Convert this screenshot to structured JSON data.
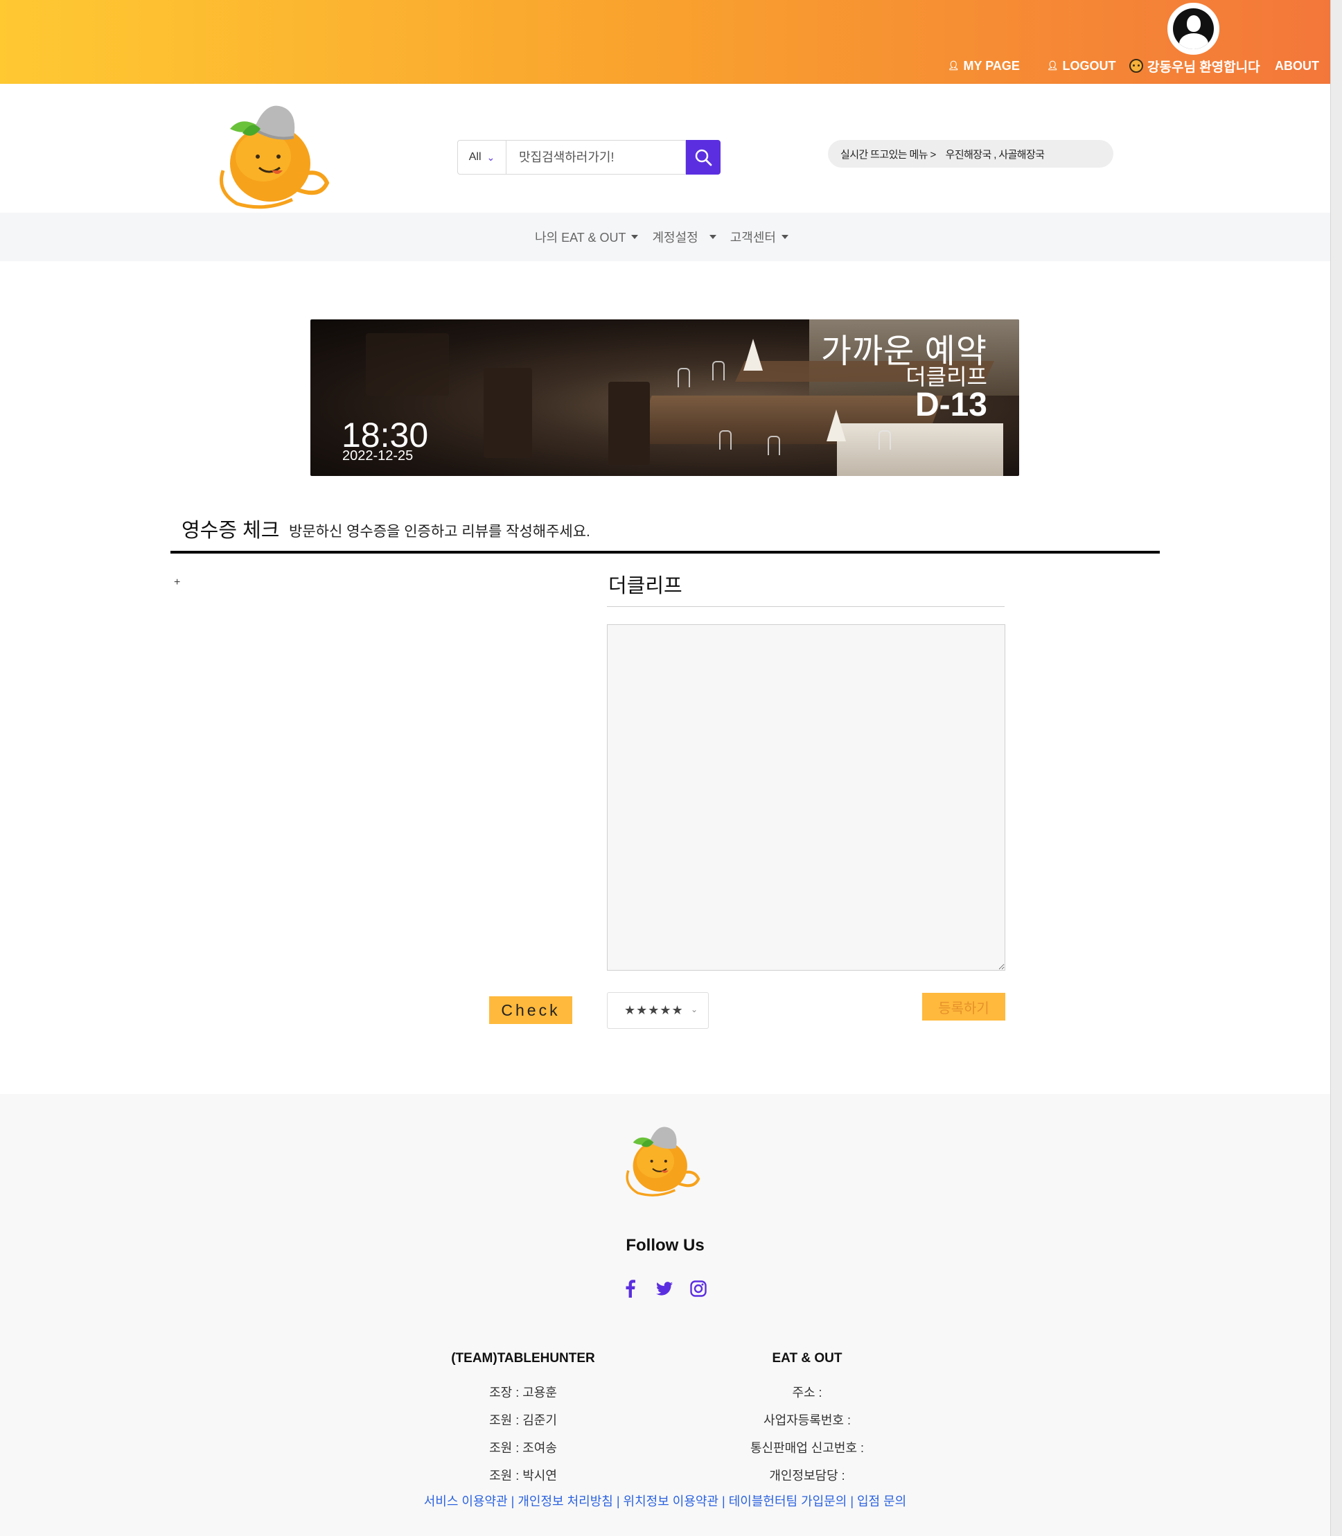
{
  "topbar": {
    "mypage": "MY PAGE",
    "logout": "LOGOUT",
    "welcome": "강동우님 환영합니다",
    "about": "ABOUT"
  },
  "search": {
    "category": "All",
    "placeholder": "맛집검색하러가기!"
  },
  "trending": {
    "label": "실시간 뜨고있는 메뉴 >",
    "items": "우진해장국 , 사골해장국"
  },
  "subnav": [
    {
      "label": "나의 EAT & OUT"
    },
    {
      "label": "계정설정"
    },
    {
      "label": "고객센터"
    }
  ],
  "banner": {
    "title": "가까운 예약",
    "restaurant": "더클리프",
    "dday": "D-13",
    "time": "18:30",
    "date": "2022-12-25"
  },
  "receipt": {
    "title": "영수증 체크",
    "description": "방문하신 영수증을 인증하고 리뷰를 작성해주세요.",
    "upload_plus": "+",
    "restaurant": "더클리프",
    "check_label": "Check",
    "rating_value": "★★★★★",
    "submit_label": "등록하기"
  },
  "footer": {
    "follow": "Follow Us",
    "team": {
      "title": "(TEAM)TABLEHUNTER",
      "lines": [
        "조장 : 고용훈",
        "조원 : 김준기",
        "조원 : 조여송",
        "조원 : 박시연"
      ]
    },
    "company": {
      "title": "EAT & OUT",
      "lines": [
        "주소 :",
        "사업자등록번호 :",
        "통신판매업 신고번호 :",
        "개인정보담당 :"
      ]
    },
    "links": [
      "서비스 이용약관",
      "개인정보 처리방침",
      "위치정보 이용약관",
      "테이블헌터팀 가입문의",
      "입점 문의"
    ]
  },
  "colors": {
    "gradient_start": "#ffc932",
    "gradient_end": "#f3773a",
    "accent_purple": "#5b2fe0",
    "button_orange": "#ffb93c",
    "link_blue": "#2b62e0"
  }
}
